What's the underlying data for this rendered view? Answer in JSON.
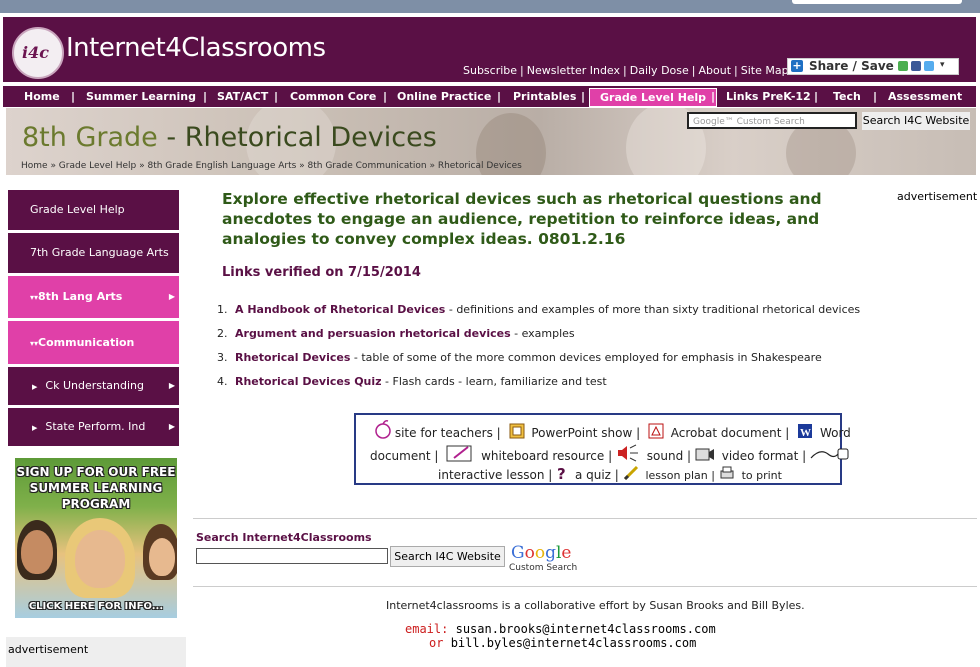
{
  "header": {
    "logo_badge": "i4c",
    "logo_text": "Internet4Classrooms",
    "top_links": [
      "Subscribe",
      "Newsletter Index",
      "Daily Dose",
      "About",
      "Site Map"
    ],
    "share_label": "Share / Save"
  },
  "nav": {
    "items": [
      "Home",
      "Summer Learning",
      "SAT/ACT",
      "Common Core",
      "Online Practice",
      "Printables",
      "Grade Level Help",
      "Links PreK-12",
      "Tech",
      "Assessment"
    ],
    "active": "Grade Level Help"
  },
  "banner": {
    "title_grade": "8th Grade",
    "title_sep": " - ",
    "title_topic": "Rhetorical Devices",
    "breadcrumb": "Home » Grade Level Help » 8th Grade English Language Arts » 8th Grade Communication » Rhetorical Devices",
    "search_placeholder": "Google™ Custom Search",
    "search_button": "Search I4C Website"
  },
  "sidebar": {
    "items": [
      "Grade Level Help",
      "7th Grade Language Arts",
      "8th Lang Arts",
      "Communication",
      "Ck Understanding",
      "State Perform. Ind"
    ],
    "promo_title": "SIGN UP FOR OUR FREE SUMMER LEARNING PROGRAM",
    "promo_cta": "CLICK HERE FOR INFO...",
    "advertisement": "advertisement"
  },
  "main": {
    "heading": "Explore effective rhetorical devices such as rhetorical questions and anecdotes to engage an audience, repetition to reinforce ideas, and analogies to convey complex ideas. 0801.2.16",
    "verified": "Links verified on 7/15/2014",
    "advertisement": "advertisement",
    "links": [
      {
        "num": "1.",
        "title": "A Handbook of Rhetorical Devices",
        "desc": " - definitions and examples of more than sixty traditional rhetorical devices"
      },
      {
        "num": "2.",
        "title": "Argument and persuasion rhetorical devices",
        "desc": "  - examples"
      },
      {
        "num": "3.",
        "title": "Rhetorical Devices",
        "desc": " - table of some of the more common devices employed for emphasis in Shakespeare"
      },
      {
        "num": "4.",
        "title": "Rhetorical Devices Quiz",
        "desc": " - Flash cards - learn, familiarize and test"
      }
    ],
    "legend": {
      "teachers": "site for teachers |",
      "powerpoint": "PowerPoint show |",
      "acrobat": "Acrobat document |",
      "word": "Word",
      "document": "document |",
      "whiteboard": "whiteboard resource |",
      "sound": "sound |",
      "video": "video format |",
      "interactive": "interactive lesson |",
      "quiz": "a quiz |",
      "lesson_plan": "lesson plan |",
      "print": "to print"
    },
    "search_label": "Search Internet4Classrooms",
    "search_button": "Search I4C Website",
    "google_custom": "Custom Search",
    "footer": "Internet4classrooms is a collaborative effort by Susan Brooks and Bill Byles.",
    "email_label": "email:",
    "email1": "susan.brooks@internet4classrooms.com",
    "or_label": "or",
    "email2": "bill.byles@internet4classrooms.com"
  }
}
